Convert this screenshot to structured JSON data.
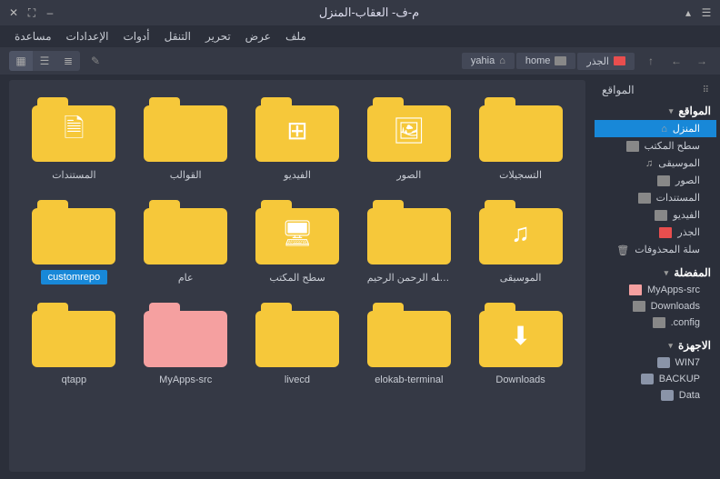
{
  "window": {
    "title": "م-ف- العقاب-المنزل"
  },
  "menu": {
    "items": [
      "ملف",
      "عرض",
      "تحرير",
      "التنقل",
      "أدوات",
      "الإعدادات",
      "مساعدة"
    ]
  },
  "breadcrumb": {
    "root": "الجذر",
    "home": "home",
    "user": "yahia"
  },
  "sidebar": {
    "top_label": "المواقع",
    "sections": [
      {
        "title": "المواقع",
        "items": [
          {
            "label": "المنزل",
            "icon": "home",
            "selected": true
          },
          {
            "label": "سطح المكتب",
            "icon": "folder"
          },
          {
            "label": "الموسيقى",
            "icon": "music"
          },
          {
            "label": "الصور",
            "icon": "folder"
          },
          {
            "label": "المستندات",
            "icon": "folder"
          },
          {
            "label": "الفيديو",
            "icon": "folder"
          },
          {
            "label": "الجذر",
            "icon": "folder-red"
          },
          {
            "label": "سلة المحذوفات",
            "icon": "trash"
          }
        ]
      },
      {
        "title": "المفضلة",
        "items": [
          {
            "label": "MyApps-src",
            "icon": "folder-pink"
          },
          {
            "label": "Downloads",
            "icon": "folder"
          },
          {
            "label": "config.",
            "icon": "folder"
          }
        ]
      },
      {
        "title": "الاجهزة",
        "items": [
          {
            "label": "WIN7",
            "icon": "disk"
          },
          {
            "label": "BACKUP",
            "icon": "disk"
          },
          {
            "label": "Data",
            "icon": "disk"
          }
        ]
      }
    ]
  },
  "folders": [
    {
      "label": "المستندات",
      "glyph": "doc"
    },
    {
      "label": "القوالب",
      "glyph": ""
    },
    {
      "label": "الفيديو",
      "glyph": "video"
    },
    {
      "label": "الصور",
      "glyph": "image"
    },
    {
      "label": "التسجيلات",
      "glyph": ""
    },
    {
      "label": "customrepo",
      "glyph": "",
      "selected": true
    },
    {
      "label": "عام",
      "glyph": ""
    },
    {
      "label": "سطح المكتب",
      "glyph": "desktop"
    },
    {
      "label": "بسم الله الرحمن الرحيم",
      "glyph": ""
    },
    {
      "label": "الموسيقى",
      "glyph": "music"
    },
    {
      "label": "qtapp",
      "glyph": ""
    },
    {
      "label": "MyApps-src",
      "glyph": "",
      "pink": true
    },
    {
      "label": "livecd",
      "glyph": ""
    },
    {
      "label": "elokab-terminal",
      "glyph": ""
    },
    {
      "label": "Downloads",
      "glyph": "download"
    }
  ]
}
